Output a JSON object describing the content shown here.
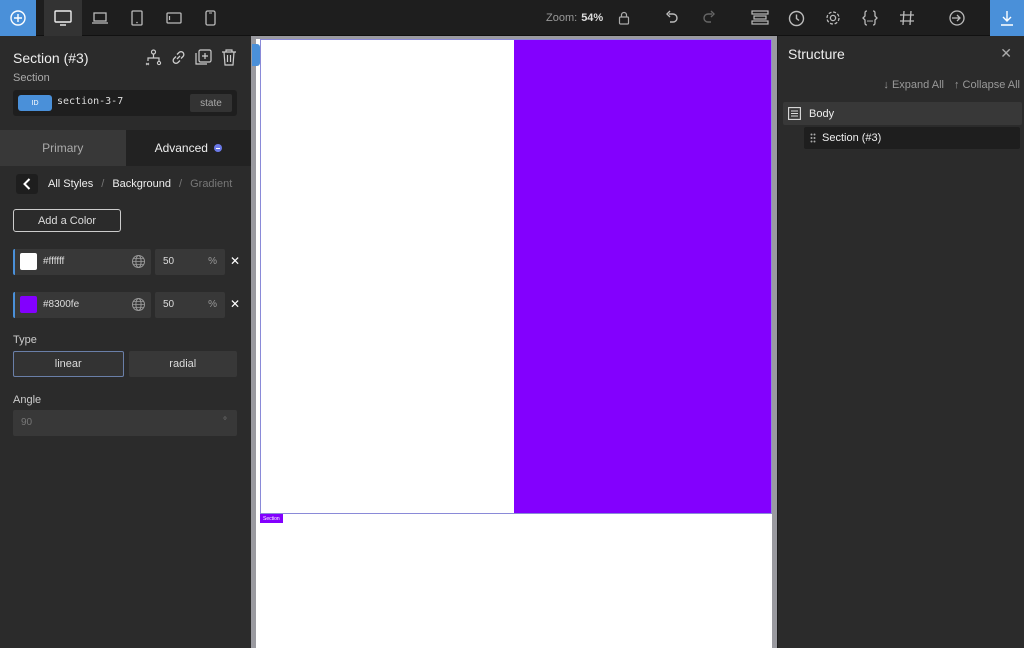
{
  "toolbar": {
    "zoom_label": "Zoom:",
    "zoom_value": "54%"
  },
  "left_panel": {
    "title": "Section (#3)",
    "subtitle": "Section",
    "id_badge": "ID",
    "id_value": "section-3-7",
    "state_label": "state",
    "tabs": [
      {
        "label": "Primary"
      },
      {
        "label": "Advanced"
      }
    ],
    "breadcrumb": [
      "All Styles",
      "Background",
      "Gradient"
    ],
    "add_color_label": "Add a Color",
    "colors": [
      {
        "hex": "#ffffff",
        "percent": "50",
        "unit": "%"
      },
      {
        "hex": "#8300fe",
        "percent": "50",
        "unit": "%"
      }
    ],
    "type_label": "Type",
    "type_options": [
      "linear",
      "radial"
    ],
    "type_selected": "linear",
    "angle_label": "Angle",
    "angle_value": "90",
    "angle_unit": "°"
  },
  "canvas": {
    "section_tag": "Section",
    "colors": {
      "left": "#ffffff",
      "right": "#8300fe"
    }
  },
  "right_panel": {
    "title": "Structure",
    "expand_all": "Expand All",
    "collapse_all": "Collapse All",
    "tree": [
      {
        "label": "Body"
      },
      {
        "label": "Section (#3)"
      }
    ]
  }
}
